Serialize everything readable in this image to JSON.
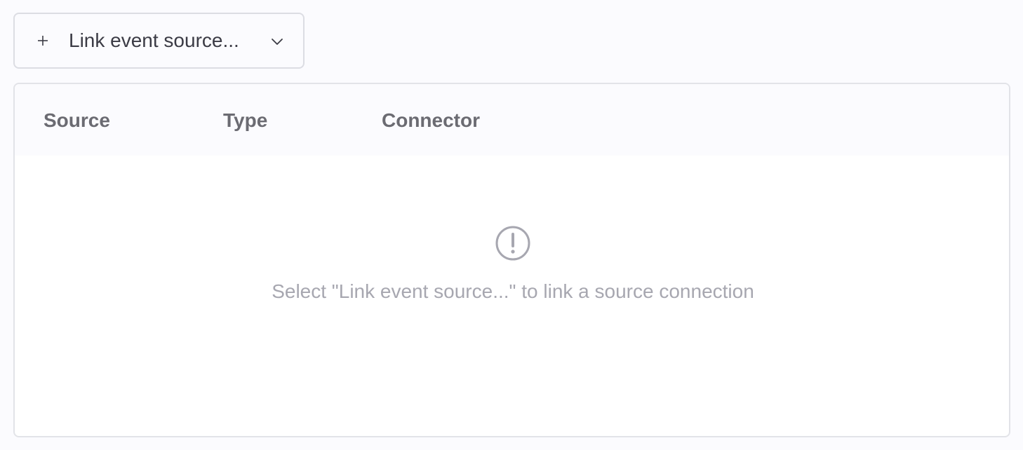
{
  "toolbar": {
    "link_button_label": "Link event source...",
    "plus_icon": "plus-icon",
    "chevron_icon": "chevron-down-icon"
  },
  "table": {
    "columns": [
      "Source",
      "Type",
      "Connector"
    ],
    "empty_state": {
      "icon": "exclamation-circle-icon",
      "message": "Select \"Link event source...\" to link a source connection"
    }
  },
  "colors": {
    "page_background": "#fbfbfe",
    "border": "#dcdde3",
    "header_text": "#6b6b72",
    "muted_text": "#a7a7b0"
  }
}
